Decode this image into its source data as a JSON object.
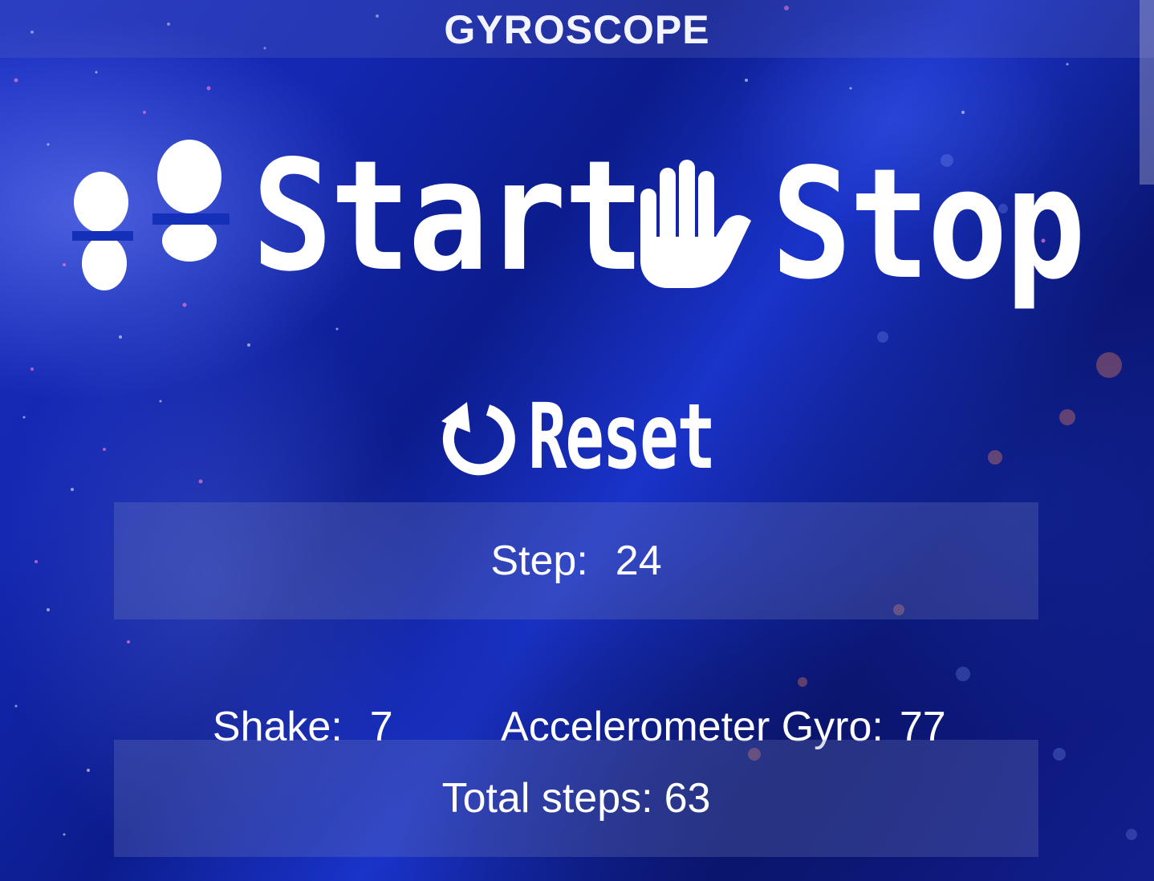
{
  "header": {
    "title": "GYROSCOPE"
  },
  "controls": {
    "start": {
      "label": "Start",
      "icon": "footprints-icon"
    },
    "stop": {
      "label": "Stop",
      "icon": "hand-icon"
    },
    "reset": {
      "label": "Reset",
      "icon": "refresh-icon"
    }
  },
  "stats": {
    "step": {
      "label": "Step:",
      "value": "24"
    },
    "shake": {
      "label": "Shake:",
      "value": "7"
    },
    "gyro": {
      "label": "Accelerometer Gyro:",
      "value": "77"
    },
    "total": {
      "label": "Total steps:",
      "value": "63"
    }
  },
  "theme": {
    "background": "#1327b0",
    "text": "#ffffff",
    "panel": "rgba(120,130,190,0.28)"
  }
}
